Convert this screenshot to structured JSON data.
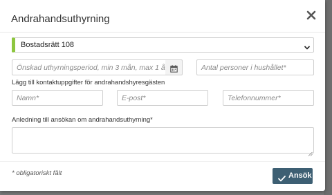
{
  "dialog": {
    "title": "Andrahandsuthyrning",
    "close_icon": "close-icon"
  },
  "apartment_select": {
    "selected": "Bostadsrätt 108",
    "accent_color": "#8dc63f"
  },
  "period": {
    "placeholder": "Önskad uthyrningsperiod, min 3 mån, max 1 år",
    "calendar_icon": "calendar-icon"
  },
  "persons": {
    "placeholder": "Antal personer i hushållet*"
  },
  "contact": {
    "heading": "Lägg till kontaktuppgifter för andrahandshyresgästen",
    "name_placeholder": "Namn*",
    "email_placeholder": "E-post*",
    "phone_placeholder": "Telefonnummer*"
  },
  "reason": {
    "label": "Anledning till ansökan om andrahandsuthyrning*",
    "value": ""
  },
  "footer": {
    "required_note": "* obligatoriskt fält",
    "submit_label": "Ansök",
    "submit_color": "#3d5f73",
    "submit_icon": "check-icon"
  }
}
